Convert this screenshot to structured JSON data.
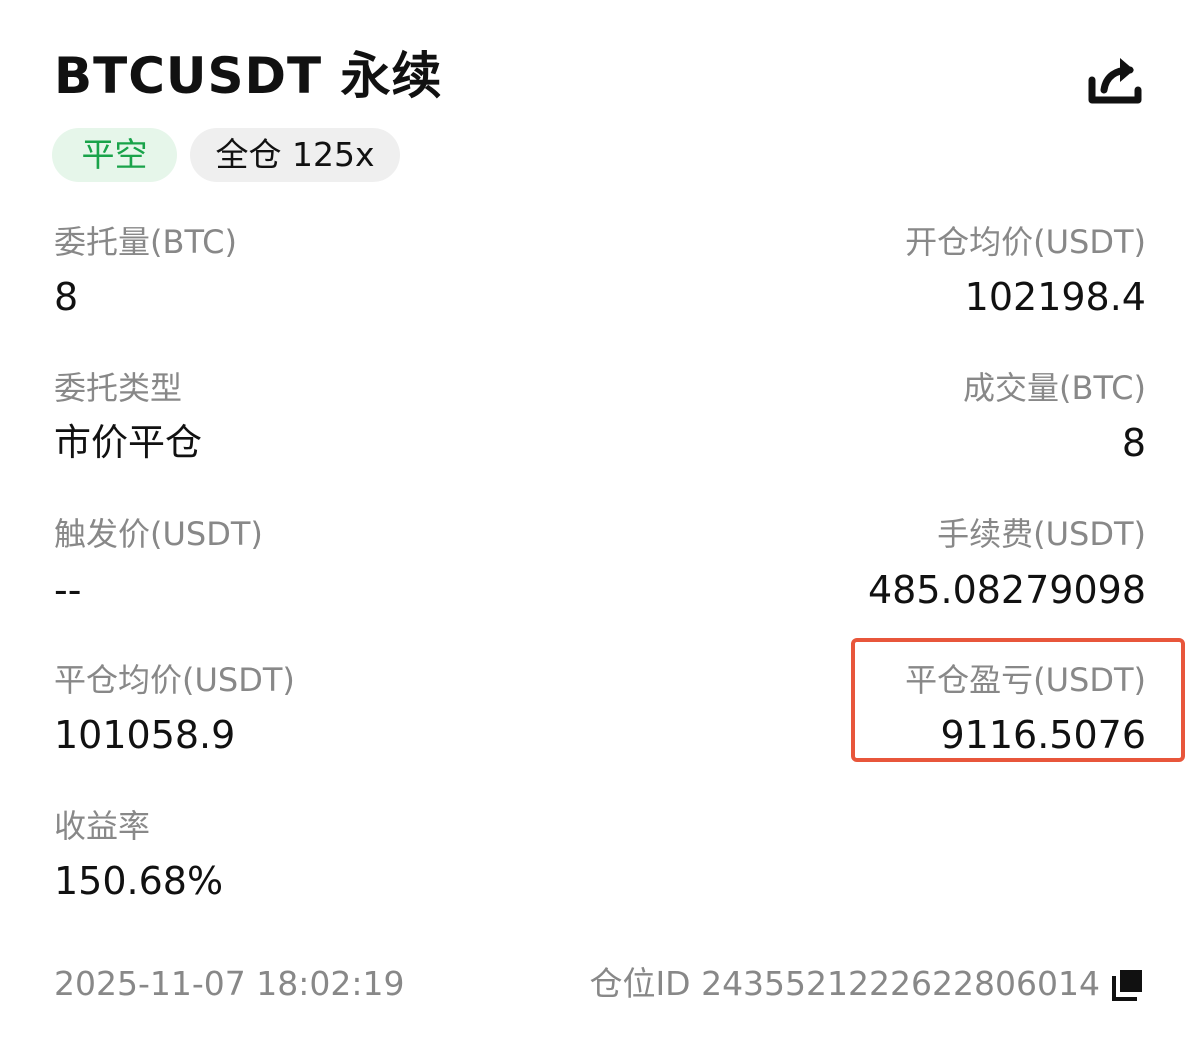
{
  "header": {
    "title": "BTCUSDT 永续",
    "share_icon": "share-icon"
  },
  "badges": {
    "side": "平空",
    "mode": "全仓 125x",
    "side_color": "#19a34a",
    "side_bg": "#e6f6ea"
  },
  "fields": {
    "order_qty": {
      "label": "委托量(BTC)",
      "value": "8"
    },
    "open_avg_price": {
      "label": "开仓均价(USDT)",
      "value": "102198.4"
    },
    "order_type": {
      "label": "委托类型",
      "value": "市价平仓"
    },
    "filled_qty": {
      "label": "成交量(BTC)",
      "value": "8"
    },
    "trigger_price": {
      "label": "触发价(USDT)",
      "value": "--"
    },
    "fee": {
      "label": "手续费(USDT)",
      "value": "485.08279098"
    },
    "close_avg_price": {
      "label": "平仓均价(USDT)",
      "value": "101058.9"
    },
    "close_pnl": {
      "label": "平仓盈亏(USDT)",
      "value": "9116.5076"
    },
    "roi": {
      "label": "收益率",
      "value": "150.68%"
    }
  },
  "footer": {
    "timestamp": "2025-11-07 18:02:19",
    "position_id": "仓位ID 2435521222622806014",
    "copy_icon": "copy-icon"
  },
  "highlight_color": "#e8563b"
}
